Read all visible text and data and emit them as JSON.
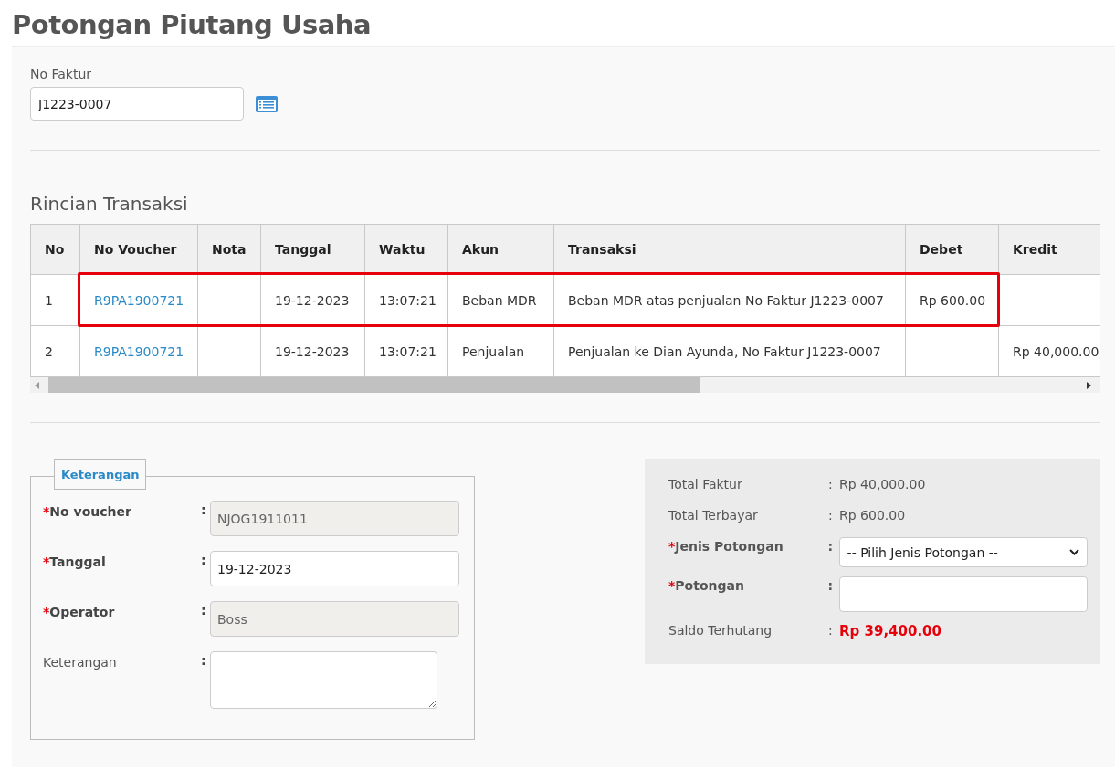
{
  "page_title": "Potongan Piutang Usaha",
  "invoice_field": {
    "label": "No Faktur",
    "value": "J1223-0007"
  },
  "section_title": "Rincian Transaksi",
  "table": {
    "columns": [
      "No",
      "No Voucher",
      "Nota",
      "Tanggal",
      "Waktu",
      "Akun",
      "Transaksi",
      "Debet",
      "Kredit"
    ],
    "rows": [
      {
        "no": "1",
        "voucher": "R9PA1900721",
        "nota": "",
        "tanggal": "19-12-2023",
        "waktu": "13:07:21",
        "akun": "Beban MDR",
        "transaksi": "Beban MDR atas penjualan No Faktur J1223-0007",
        "debet": "Rp 600.00",
        "kredit": "",
        "highlighted": true
      },
      {
        "no": "2",
        "voucher": "R9PA1900721",
        "nota": "",
        "tanggal": "19-12-2023",
        "waktu": "13:07:21",
        "akun": "Penjualan",
        "transaksi": "Penjualan ke Dian Ayunda, No Faktur J1223-0007",
        "debet": "",
        "kredit": "Rp 40,000.00",
        "highlighted": false
      }
    ]
  },
  "keterangan": {
    "legend": "Keterangan",
    "fields": [
      {
        "kind": "input",
        "marker": "*",
        "label": "No voucher",
        "colon": ":",
        "value": "NJOG1911011",
        "disabled": true
      },
      {
        "kind": "input",
        "marker": "*",
        "label": "Tanggal",
        "colon": ":",
        "value": "19-12-2023",
        "disabled": false
      },
      {
        "kind": "input",
        "marker": "*",
        "label": "Operator",
        "colon": ":",
        "value": "Boss",
        "disabled": true
      },
      {
        "kind": "textarea",
        "label": "Keterangan",
        "colon": ":"
      }
    ]
  },
  "summary": {
    "rows": [
      {
        "kind": "text",
        "label": "Total Faktur",
        "colon": ":",
        "value": "Rp 40,000.00"
      },
      {
        "kind": "text",
        "label": "Total Terbayar",
        "colon": ":",
        "value": "Rp 600.00"
      },
      {
        "kind": "select",
        "marker": "*",
        "label": "Jenis Potongan",
        "colon": ":",
        "value": "-- Pilih Jenis Potongan --"
      },
      {
        "kind": "input",
        "marker": "*",
        "label": "Potongan",
        "colon": ":"
      },
      {
        "kind": "total",
        "label": "Saldo Terhutang",
        "colon": ":",
        "value": "Rp 39,400.00"
      }
    ]
  }
}
